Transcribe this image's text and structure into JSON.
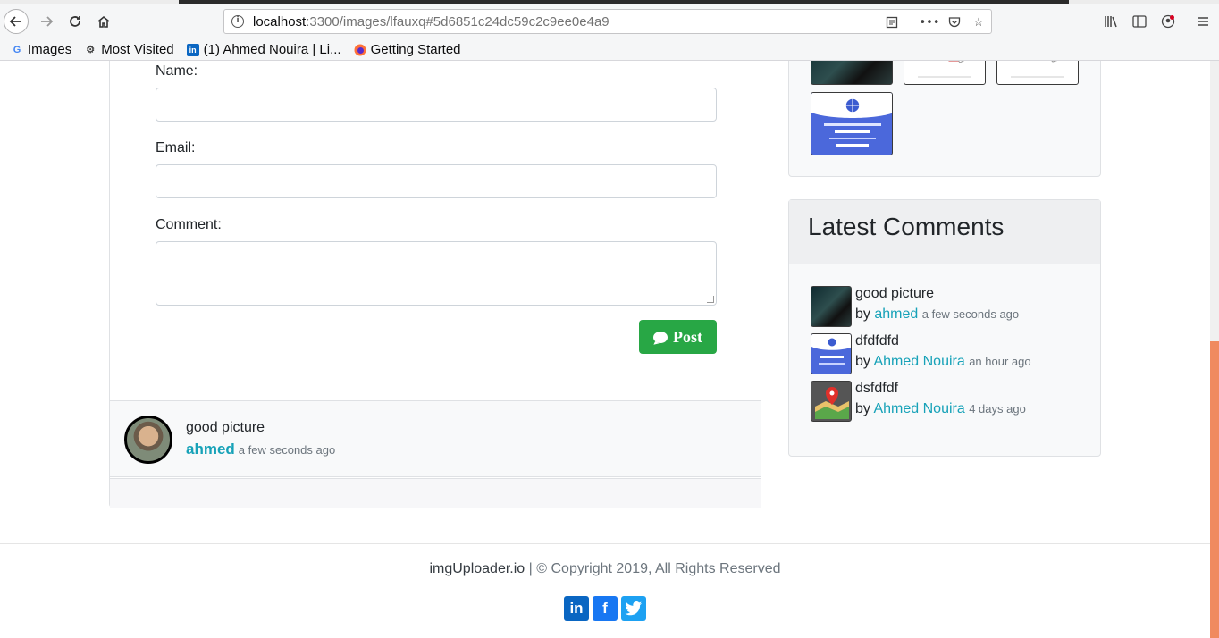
{
  "browser": {
    "url_host": "localhost",
    "url_rest": ":3300/images/lfauxq#5d6851c24dc59c2c9ee0e4a9",
    "bookmarks": [
      {
        "label": "Images",
        "icon": "google-icon"
      },
      {
        "label": "Most Visited",
        "icon": "gear-icon"
      },
      {
        "label": "(1) Ahmed Nouira | Li...",
        "icon": "linkedin-icon"
      },
      {
        "label": "Getting Started",
        "icon": "firefox-icon"
      }
    ]
  },
  "form": {
    "name_label": "Name:",
    "name_value": "",
    "email_label": "Email:",
    "email_value": "",
    "comment_label": "Comment:",
    "comment_value": "",
    "post_label": "Post"
  },
  "comments": [
    {
      "text": "good picture",
      "author": "ahmed",
      "time": "a few seconds ago"
    }
  ],
  "sidebar": {
    "latest_title": "Latest Comments",
    "by_word": "by",
    "latest": [
      {
        "text": "good picture",
        "author": "ahmed",
        "time": "a few seconds ago"
      },
      {
        "text": "dfdfdfd",
        "author": "Ahmed Nouira",
        "time": "an hour ago"
      },
      {
        "text": "dsfdfdf",
        "author": "Ahmed Nouira",
        "time": "4 days ago"
      }
    ]
  },
  "footer": {
    "brand": "imgUploader.io",
    "copyright": " | © Copyright 2019, All Rights Reserved",
    "social_icons": [
      "linkedin-icon",
      "facebook-icon",
      "twitter-icon"
    ]
  },
  "colors": {
    "accent": "#17a2b8",
    "post_button": "#28a745",
    "scroll_thumb": "#f08a60"
  }
}
